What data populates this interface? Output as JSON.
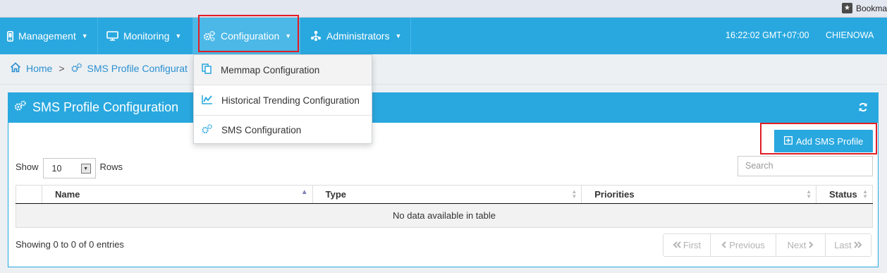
{
  "browser": {
    "bookmarks_label": "Bookma"
  },
  "nav": {
    "items": [
      {
        "label": "Management",
        "icon": "mobile-icon"
      },
      {
        "label": "Monitoring",
        "icon": "monitor-icon"
      },
      {
        "label": "Configuration",
        "icon": "gears-icon"
      },
      {
        "label": "Administrators",
        "icon": "sitemap-icon"
      }
    ],
    "time": "16:22:02 GMT+07:00",
    "user": "CHIENOWA"
  },
  "breadcrumb": {
    "home": "Home",
    "current": "SMS Profile Configurat"
  },
  "dropdown": {
    "items": [
      {
        "label": "Memmap Configuration",
        "icon": "copy-icon"
      },
      {
        "label": "Historical Trending Configuration",
        "icon": "chart-line-icon"
      },
      {
        "label": "SMS Configuration",
        "icon": "gears-icon"
      }
    ]
  },
  "panel": {
    "title": "SMS Profile Configuration",
    "add_button": "Add SMS Profile",
    "show_label": "Show",
    "page_size": "10",
    "rows_label": "Rows",
    "search_placeholder": "Search",
    "columns": [
      "Name",
      "Type",
      "Priorities",
      "Status"
    ],
    "empty_message": "No data available in table",
    "info": "Showing 0 to 0 of 0 entries",
    "pager": {
      "first": "First",
      "previous": "Previous",
      "next": "Next",
      "last": "Last"
    }
  },
  "colors": {
    "primary": "#29a8df",
    "highlight": "#e21d25",
    "link": "#2b8fd0"
  }
}
